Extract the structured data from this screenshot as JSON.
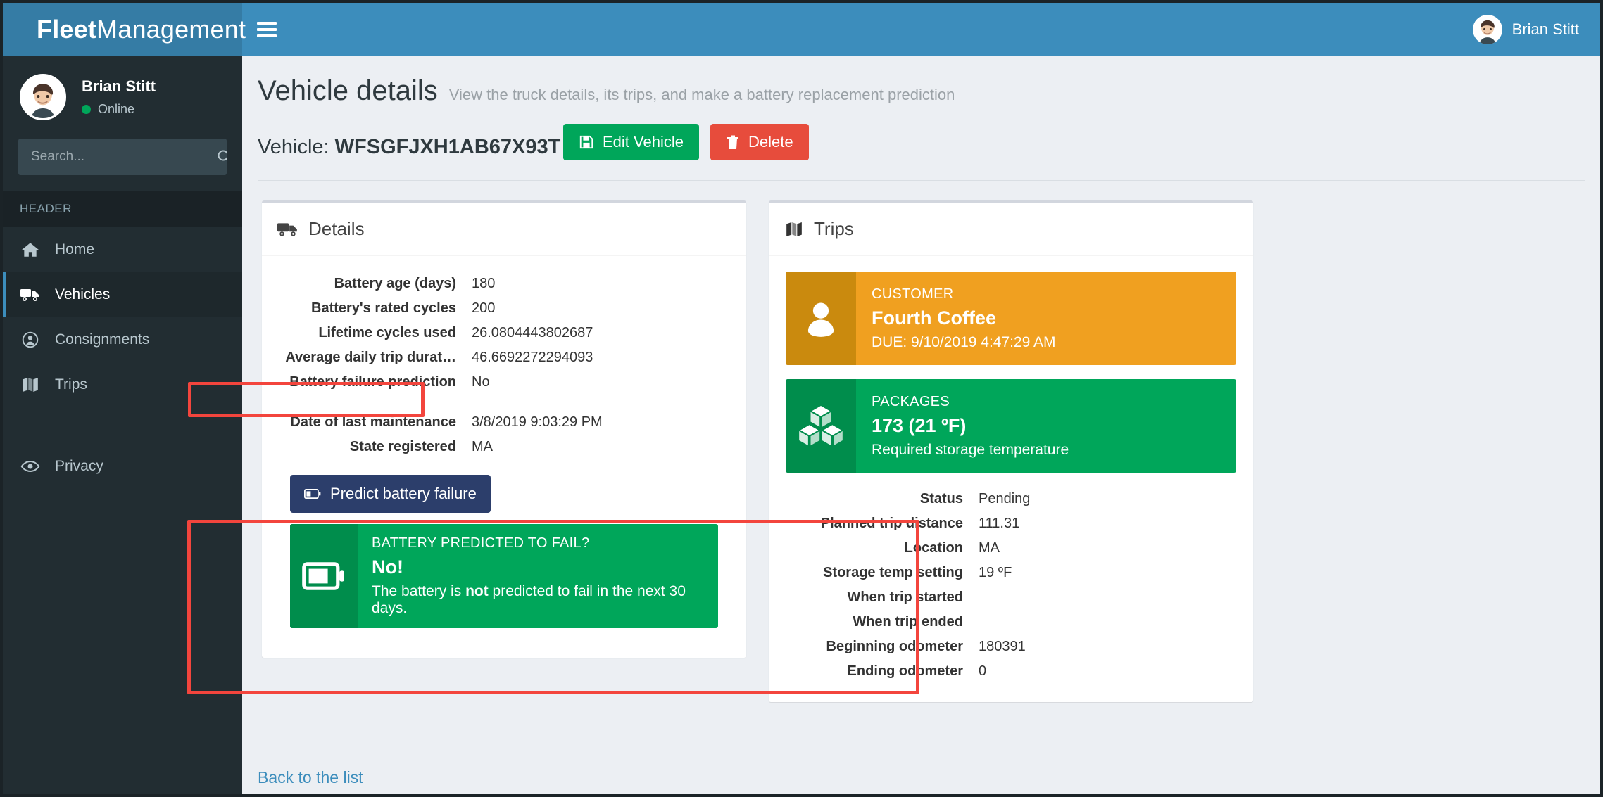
{
  "topbar": {
    "brand_bold": "Fleet",
    "brand_light": "Management",
    "menu_toggle_icon": "hamburger-icon",
    "user_name": "Brian Stitt"
  },
  "sidebar": {
    "user": {
      "name": "Brian Stitt",
      "status": "Online",
      "status_color": "#00a65a"
    },
    "search": {
      "placeholder": "Search...",
      "value": "",
      "icon": "search-icon"
    },
    "section_header": "HEADER",
    "items": [
      {
        "label": "Home",
        "icon": "home-icon",
        "active": false
      },
      {
        "label": "Vehicles",
        "icon": "truck-icon",
        "active": true
      },
      {
        "label": "Consignments",
        "icon": "user-circle-icon",
        "active": false
      },
      {
        "label": "Trips",
        "icon": "map-icon",
        "active": false
      }
    ],
    "footer_items": [
      {
        "label": "Privacy",
        "icon": "eye-icon"
      }
    ]
  },
  "page": {
    "title": "Vehicle details",
    "subtitle": "View the truck details, its trips, and make a battery replacement prediction",
    "vehicle_label": "Vehicle:",
    "vehicle_id": "WFSGFJXH1AB67X93T",
    "back_link": "Back to the list"
  },
  "actions": {
    "edit_label": "Edit Vehicle",
    "edit_icon": "save-icon",
    "edit_color": "#00a65a",
    "delete_label": "Delete",
    "delete_icon": "trash-icon",
    "delete_color": "#e74c3c"
  },
  "details_panel": {
    "title": "Details",
    "icon": "truck-icon",
    "rows_group_1": [
      {
        "label": "Battery age (days)",
        "value": "180"
      },
      {
        "label": "Battery's rated cycles",
        "value": "200"
      },
      {
        "label": "Lifetime cycles used",
        "value": "26.0804443802687"
      },
      {
        "label": "Average daily trip durat…",
        "value": "46.6692272294093"
      },
      {
        "label": "Battery failure prediction",
        "value": "No"
      }
    ],
    "rows_group_2": [
      {
        "label": "Date of last maintenance",
        "value": "3/8/2019 9:03:29 PM"
      },
      {
        "label": "State registered",
        "value": "MA"
      }
    ],
    "predict": {
      "button_label": "Predict battery failure",
      "button_icon": "battery-icon",
      "button_color": "#2c3e6b",
      "result_icon": "battery-icon",
      "result_color": "#00a65a",
      "kicker": "BATTERY PREDICTED TO FAIL?",
      "headline": "No!",
      "text_before": "The battery is ",
      "text_bold": "not",
      "text_after": " predicted to fail in the next 30 days."
    }
  },
  "trips_panel": {
    "title": "Trips",
    "icon": "map-icon",
    "cards": [
      {
        "kicker": "CUSTOMER",
        "title": "Fourth Coffee",
        "sub": "DUE: 9/10/2019 4:47:29 AM",
        "icon": "user-icon",
        "color": "#f0a020"
      },
      {
        "kicker": "PACKAGES",
        "title": "173 (21 ºF)",
        "sub": "Required storage temperature",
        "icon": "boxes-icon",
        "color": "#00a65a"
      }
    ],
    "rows": [
      {
        "label": "Status",
        "value": "Pending"
      },
      {
        "label": "Planned trip distance",
        "value": "111.31"
      },
      {
        "label": "Location",
        "value": "MA"
      },
      {
        "label": "Storage temp setting",
        "value": "19 ºF"
      },
      {
        "label": "When trip started",
        "value": ""
      },
      {
        "label": "When trip ended",
        "value": ""
      },
      {
        "label": "Beginning odometer",
        "value": "180391"
      },
      {
        "label": "Ending odometer",
        "value": "0"
      }
    ]
  },
  "annotations": {
    "color": "#f3453d",
    "boxes": [
      {
        "name": "details-rows-highlight"
      },
      {
        "name": "prediction-section-highlight"
      }
    ]
  }
}
